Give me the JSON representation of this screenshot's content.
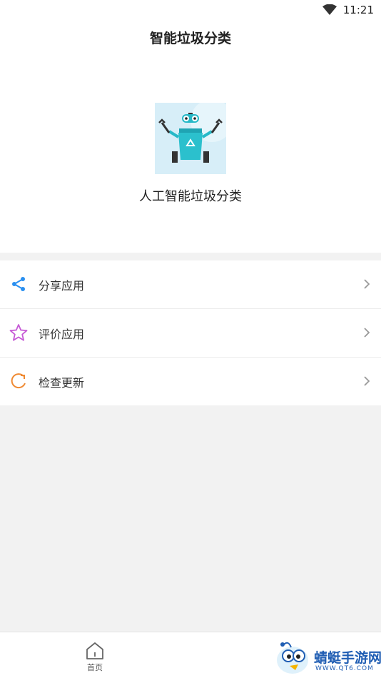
{
  "status_bar": {
    "time": "11:21"
  },
  "header": {
    "title": "智能垃圾分类"
  },
  "hero": {
    "app_name": "人工智能垃圾分类",
    "logo_icon": "robot-trash-bin-logo"
  },
  "menu": {
    "items": [
      {
        "label": "分享应用",
        "icon": "share-icon",
        "color": "#2a8ff0"
      },
      {
        "label": "评价应用",
        "icon": "star-icon",
        "color": "#c65ad6"
      },
      {
        "label": "检查更新",
        "icon": "refresh-icon",
        "color": "#ef8a33"
      }
    ]
  },
  "bottom_nav": {
    "home_label": "首页"
  },
  "watermark": {
    "text": "蜻蜓手游网",
    "url": "WWW.QT6.COM"
  }
}
